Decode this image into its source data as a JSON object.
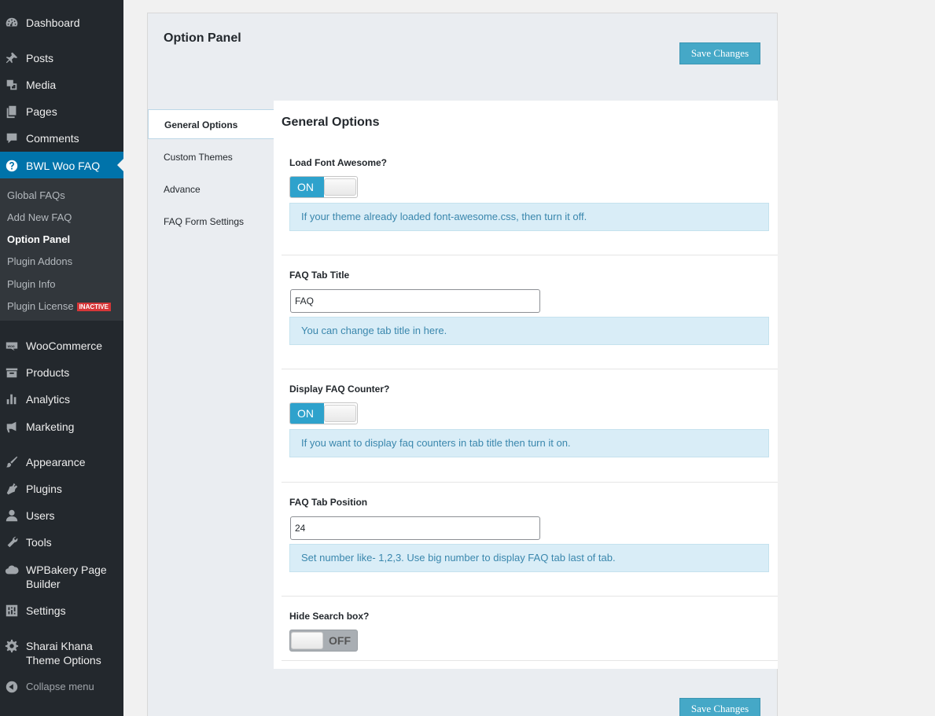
{
  "sidebar": {
    "items": [
      {
        "label": "Dashboard",
        "icon": "dashboard-icon"
      },
      {
        "label": "Posts",
        "icon": "pin-icon"
      },
      {
        "label": "Media",
        "icon": "media-icon"
      },
      {
        "label": "Pages",
        "icon": "pages-icon"
      },
      {
        "label": "Comments",
        "icon": "comment-icon"
      },
      {
        "label": "BWL Woo FAQ",
        "icon": "question-icon"
      },
      {
        "label": "WooCommerce",
        "icon": "woo-icon"
      },
      {
        "label": "Products",
        "icon": "archive-icon"
      },
      {
        "label": "Analytics",
        "icon": "chart-bar-icon"
      },
      {
        "label": "Marketing",
        "icon": "megaphone-icon"
      },
      {
        "label": "Appearance",
        "icon": "brush-icon"
      },
      {
        "label": "Plugins",
        "icon": "plugin-icon"
      },
      {
        "label": "Users",
        "icon": "user-icon"
      },
      {
        "label": "Tools",
        "icon": "wrench-icon"
      },
      {
        "label": "WPBakery Page Builder",
        "icon": "cloud-icon"
      },
      {
        "label": "Settings",
        "icon": "settings-icon"
      },
      {
        "label": "Sharai Khana Theme Options",
        "icon": "gear-icon"
      }
    ],
    "submenu": [
      {
        "label": "Global FAQs"
      },
      {
        "label": "Add New FAQ"
      },
      {
        "label": "Option Panel"
      },
      {
        "label": "Plugin Addons"
      },
      {
        "label": "Plugin Info"
      },
      {
        "label": "Plugin License",
        "badge": "INACTIVE"
      }
    ],
    "collapse_label": "Collapse menu"
  },
  "panel": {
    "title": "Option Panel",
    "save_label": "Save Changes",
    "tabs": [
      {
        "label": "General Options"
      },
      {
        "label": "Custom Themes"
      },
      {
        "label": "Advance"
      },
      {
        "label": "FAQ Form Settings"
      }
    ],
    "section_title": "General Options",
    "fields": {
      "font_awesome": {
        "label": "Load Font Awesome?",
        "state": "ON",
        "help": "If your theme already loaded font-awesome.css, then turn it off."
      },
      "tab_title": {
        "label": "FAQ Tab Title",
        "value": "FAQ",
        "help": "You can change tab title in here."
      },
      "counter": {
        "label": "Display FAQ Counter?",
        "state": "ON",
        "help": "If you want to display faq counters in tab title then turn it on."
      },
      "tab_position": {
        "label": "FAQ Tab Position",
        "value": "24",
        "help": "Set number like- 1,2,3. Use big number to display FAQ tab last of tab."
      },
      "search_box": {
        "label": "Hide Search box?",
        "state": "OFF"
      }
    }
  },
  "colors": {
    "sidebar_bg": "#23282d",
    "accent": "#0073aa",
    "button": "#45a8c7",
    "toggle_on": "#2ea2cc",
    "help_bg": "#d9edf7"
  }
}
